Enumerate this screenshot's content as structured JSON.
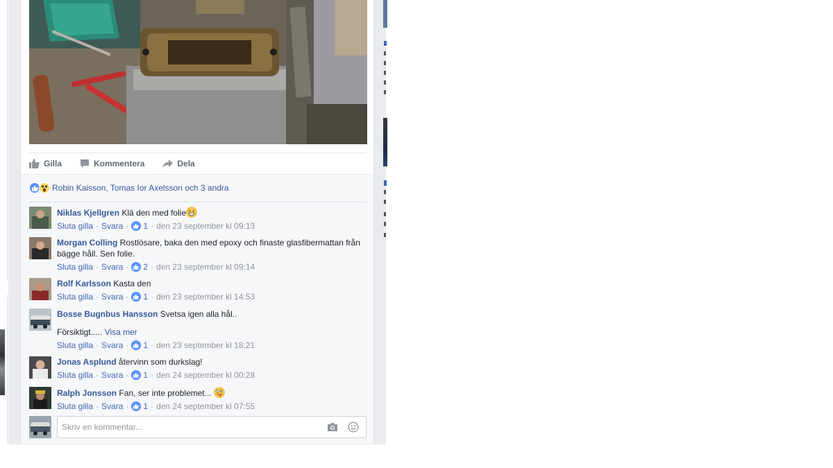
{
  "post": {
    "actions": {
      "like": "Gilla",
      "comment": "Kommentera",
      "share": "Dela"
    },
    "reactions_text": "Robin Kaisson, Tomas Ior Axelsson och 3 andra"
  },
  "comments": [
    {
      "author": "Niklas Kjellgren",
      "text": "Klä den med folie",
      "emoji": "grin",
      "unlike": "Sluta gilla",
      "reply": "Svara",
      "likes": "1",
      "time": "den 23 september kl 09:13"
    },
    {
      "author": "Morgan Colling",
      "text": "Rostlösare, baka den med epoxy och finaste glasfibermattan från bägge håll. Sen folie.",
      "unlike": "Sluta gilla",
      "reply": "Svara",
      "likes": "2",
      "time": "den 23 september kl 09:14"
    },
    {
      "author": "Rolf Karlsson",
      "text": "Kasta den",
      "unlike": "Sluta gilla",
      "reply": "Svara",
      "likes": "1",
      "time": "den 23 september kl 14:53"
    },
    {
      "author": "Bosse Bugnbus Hansson",
      "text": "Svetsa igen alla hål..",
      "text2": "Försiktigt.....",
      "more": "Visa mer",
      "unlike": "Sluta gilla",
      "reply": "Svara",
      "likes": "1",
      "time": "den 23 september kl 18:21"
    },
    {
      "author": "Jonas Asplund",
      "text": "återvinn som durkslag!",
      "unlike": "Sluta gilla",
      "reply": "Svara",
      "likes": "1",
      "time": "den 24 september kl 00:28"
    },
    {
      "author": "Ralph Jonsson",
      "text": "Fan, ser inte problemet...",
      "emoji": "tongue",
      "unlike": "Sluta gilla",
      "reply": "Svara",
      "likes": "1",
      "time": "den 24 september kl 07:55"
    }
  ],
  "composer": {
    "placeholder": "Skriv en kommentar..."
  },
  "icons": {
    "like": "thumbs-up-icon",
    "comment": "speech-bubble-icon",
    "share": "share-arrow-icon",
    "camera": "camera-icon",
    "emoji": "smiley-icon",
    "reaction_like": "like-reaction-icon",
    "reaction_wow": "wow-reaction-icon"
  },
  "colors": {
    "link": "#365899",
    "meta_link": "#4267b2",
    "meta_text": "#90949c",
    "like_blue": "#5890ff",
    "wow_yellow": "#fcd65c",
    "page_bg": "#e9ebee",
    "comment_bg": "#f6f7f9"
  }
}
